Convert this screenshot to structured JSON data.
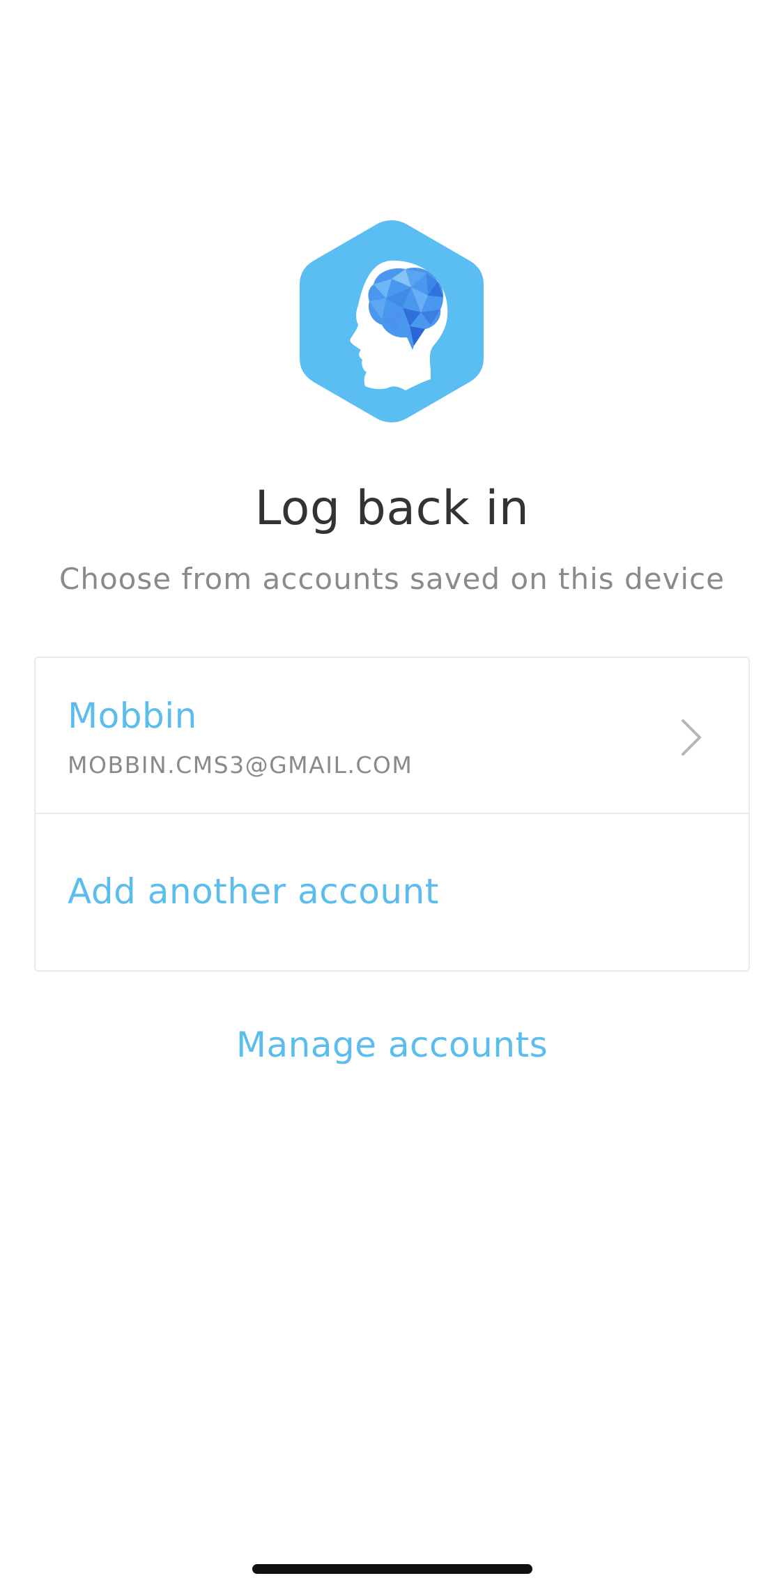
{
  "header": {
    "logo_icon": "brain-head-icon",
    "title": "Log back in",
    "subtitle": "Choose from accounts saved on this device"
  },
  "accounts": {
    "items": [
      {
        "name": "Mobbin",
        "email": "MOBBIN.CMS3@GMAIL.COM",
        "icon": "chevron-right-icon"
      }
    ],
    "add_label": "Add another account"
  },
  "footer": {
    "manage_label": "Manage accounts"
  },
  "colors": {
    "accent": "#5bbcee",
    "title": "#333333",
    "muted": "#8a8a8a",
    "border": "#eaeaea",
    "brain": "#3f8fea"
  }
}
